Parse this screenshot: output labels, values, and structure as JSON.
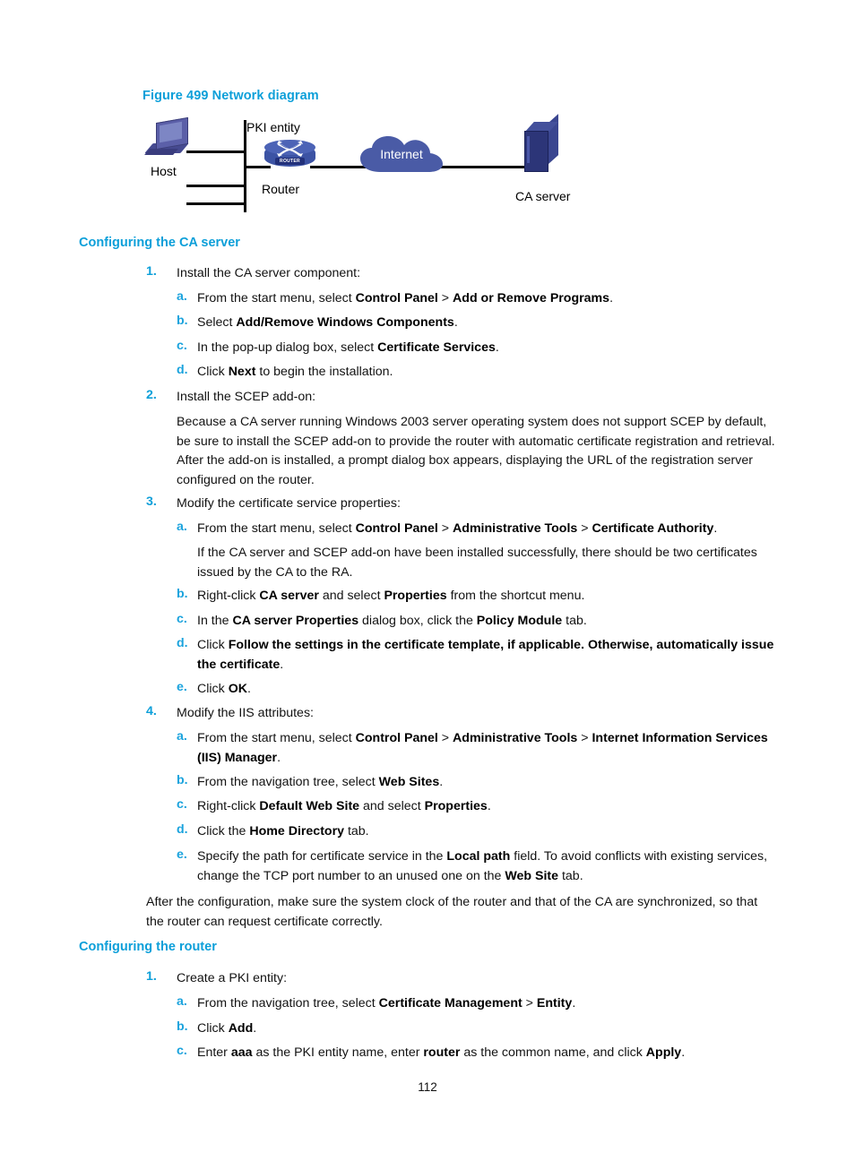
{
  "figure": {
    "caption": "Figure 499 Network diagram",
    "nodes": {
      "host_label": "Host",
      "pki_entity_label": "PKI entity",
      "router_label": "Router",
      "router_badge": "ROUTER",
      "internet_label": "Internet",
      "ca_server_label": "CA server"
    },
    "colors": {
      "caption": "#0c9fd9",
      "cloud": "#4a5ba6",
      "router": "#3c53a4",
      "ca_server": "#2c3578",
      "host": "#5b5fa8",
      "wire": "#000000"
    }
  },
  "sections": [
    {
      "heading": "Configuring the CA server",
      "steps": [
        {
          "marker": "1.",
          "text": "Install the CA server component:",
          "subs": [
            {
              "marker": "a.",
              "html": "From the start menu, select <b>Control Panel</b> &gt; <b>Add or Remove Programs</b>."
            },
            {
              "marker": "b.",
              "html": "Select <b>Add/Remove Windows Components</b>."
            },
            {
              "marker": "c.",
              "html": "In the pop-up dialog box, select <b>Certificate Services</b>."
            },
            {
              "marker": "d.",
              "html": "Click <b>Next</b> to begin the installation."
            }
          ]
        },
        {
          "marker": "2.",
          "text": "Install the SCEP add-on:",
          "body": "Because a CA server running Windows 2003 server operating system does not support SCEP by default, be sure to install the SCEP add-on to provide the router with automatic certificate registration and retrieval. After the add-on is installed, a prompt dialog box appears, displaying the URL of the registration server configured on the router."
        },
        {
          "marker": "3.",
          "text": "Modify the certificate service properties:",
          "subs": [
            {
              "marker": "a.",
              "html": "From the start menu, select <b>Control Panel</b> &gt; <b>Administrative Tools</b> &gt; <b>Certificate Authority</b>.",
              "note": "If the CA server and SCEP add-on have been installed successfully, there should be two certificates issued by the CA to the RA."
            },
            {
              "marker": "b.",
              "html": "Right-click <b>CA server</b> and select <b>Properties</b> from the shortcut menu."
            },
            {
              "marker": "c.",
              "html": "In the <b>CA server Properties</b> dialog box, click the <b>Policy Module</b> tab."
            },
            {
              "marker": "d.",
              "html": "Click <b>Follow the settings in the certificate template, if applicable. Otherwise, automatically issue the certificate</b>."
            },
            {
              "marker": "e.",
              "html": "Click <b>OK</b>."
            }
          ]
        },
        {
          "marker": "4.",
          "text": "Modify the IIS attributes:",
          "subs": [
            {
              "marker": "a.",
              "html": "From the start menu, select <b>Control Panel</b> &gt; <b>Administrative Tools</b> &gt; <b>Internet Information Services (IIS) Manager</b>."
            },
            {
              "marker": "b.",
              "html": "From the navigation tree, select <b>Web Sites</b>."
            },
            {
              "marker": "c.",
              "html": "Right-click <b>Default Web Site</b> and select <b>Properties</b>."
            },
            {
              "marker": "d.",
              "html": "Click the <b>Home Directory</b> tab."
            },
            {
              "marker": "e.",
              "html": "Specify the path for certificate service in the <b>Local path</b> field. To avoid conflicts with existing services, change the TCP port number to an unused one on the <b>Web Site</b> tab."
            }
          ]
        }
      ],
      "closing": "After the configuration, make sure the system clock of the router and that of the CA are synchronized, so that the router can request certificate correctly."
    },
    {
      "heading": "Configuring the router",
      "steps": [
        {
          "marker": "1.",
          "text": "Create a PKI entity:",
          "subs": [
            {
              "marker": "a.",
              "html": "From the navigation tree, select <b>Certificate Management</b> &gt; <b>Entity</b>."
            },
            {
              "marker": "b.",
              "html": "Click <b>Add</b>."
            },
            {
              "marker": "c.",
              "html": "Enter <b>aaa</b> as the PKI entity name, enter <b>router</b> as the common name, and click <b>Apply</b>."
            }
          ]
        }
      ]
    }
  ],
  "footer": {
    "page_number": "112"
  }
}
